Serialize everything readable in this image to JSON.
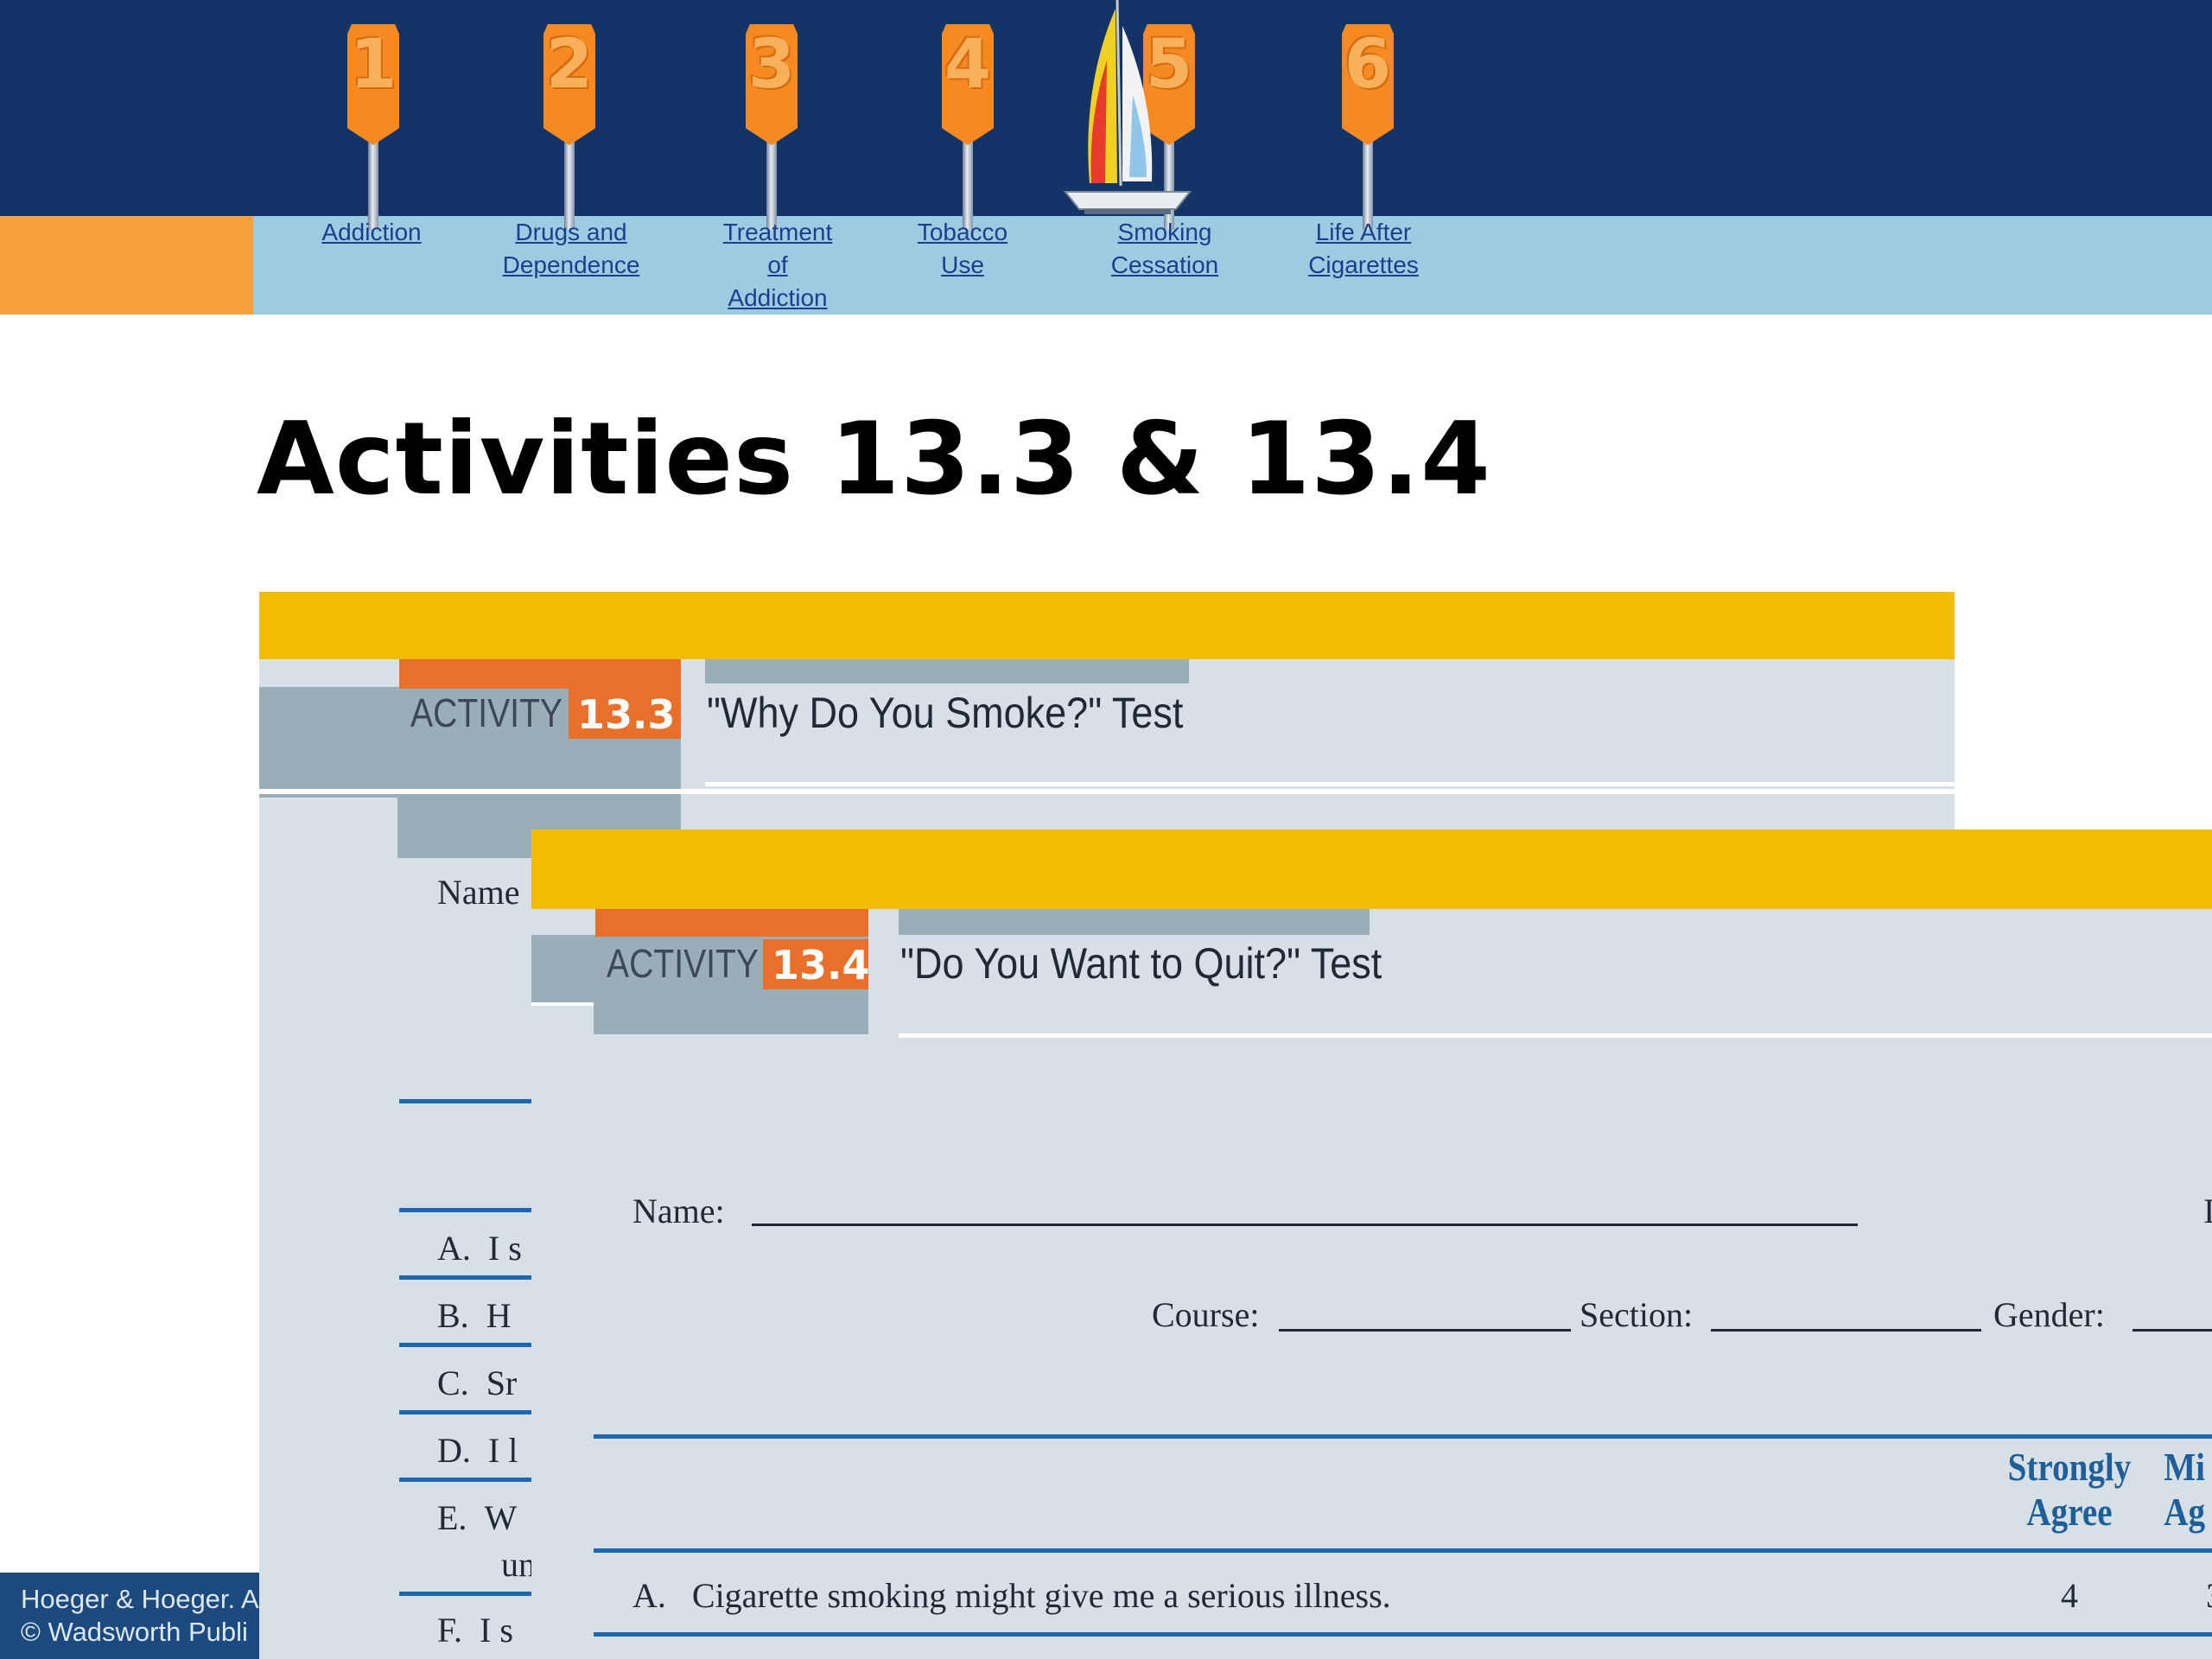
{
  "nav": {
    "items": [
      {
        "number": "1",
        "label_lines": [
          "Addiction"
        ]
      },
      {
        "number": "2",
        "label_lines": [
          "Drugs and",
          "Dependence"
        ]
      },
      {
        "number": "3",
        "label_lines": [
          "Treatment",
          "of",
          "Addiction"
        ]
      },
      {
        "number": "4",
        "label_lines": [
          "Tobacco",
          "Use"
        ]
      },
      {
        "number": "5",
        "label_lines": [
          "Smoking",
          "Cessation"
        ]
      },
      {
        "number": "6",
        "label_lines": [
          "Life After",
          "Cigarettes"
        ]
      }
    ]
  },
  "slide": {
    "title": "Activities 13.3 & 13.4"
  },
  "activity_133": {
    "label": "ACTIVITY",
    "badge": "13.3",
    "title": "\"Why Do You Smoke?\" Test",
    "name_label": "Name",
    "items": [
      {
        "letter": "A.",
        "text": "I s"
      },
      {
        "letter": "B.",
        "text": "H"
      },
      {
        "letter": "C.",
        "text": "Sr"
      },
      {
        "letter": "D.",
        "text": "I l"
      },
      {
        "letter": "E.",
        "text": "W",
        "text2": "un"
      },
      {
        "letter": "F.",
        "text": "I s"
      }
    ]
  },
  "activity_134": {
    "label": "ACTIVITY",
    "badge": "13.4",
    "title": "\"Do You Want to Quit?\" Test",
    "name_label": "Name:",
    "name_trail": "I",
    "course_label": "Course:",
    "section_label": "Section:",
    "gender_label": "Gender:",
    "columns": [
      {
        "lines": [
          "Strongly",
          "Agree"
        ]
      },
      {
        "lines": [
          "Mi",
          "Ag"
        ]
      }
    ],
    "rows": [
      {
        "letter": "A.",
        "text": "Cigarette smoking might give me a serious illness.",
        "values": [
          "4",
          "3"
        ]
      }
    ]
  },
  "footer": {
    "line1": "Hoeger & Hoeger. A",
    "line2": "© Wadsworth Publi"
  },
  "colors": {
    "navy": "#143367",
    "light_blue": "#9dcbe2",
    "orange": "#f7a13c",
    "activity_yellow": "#f2bc00",
    "activity_orange": "#e9702a",
    "activity_gray": "#99aeb9",
    "activity_bg": "#d7e0e6",
    "rule_blue": "#1e67b0",
    "link": "#1d3e8d"
  },
  "icons": {
    "nav_marker": "orange-number-sign-on-post-icon",
    "decoration": "sailboat-icon"
  }
}
